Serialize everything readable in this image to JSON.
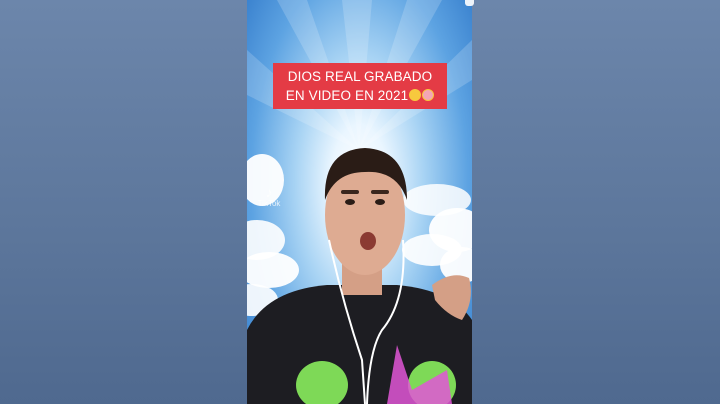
{
  "caption": {
    "line1": "DIOS REAL GRABADO",
    "line2": "EN VIDEO EN 2021"
  },
  "watermark": {
    "icon": "tiktok-note-icon",
    "text": "TikTok"
  },
  "colors": {
    "caption_bg": "#e43b45",
    "side_panel": "#5a7499",
    "sky": "#5da3e2"
  },
  "emojis": [
    "face-emoji",
    "monkey-emoji"
  ]
}
